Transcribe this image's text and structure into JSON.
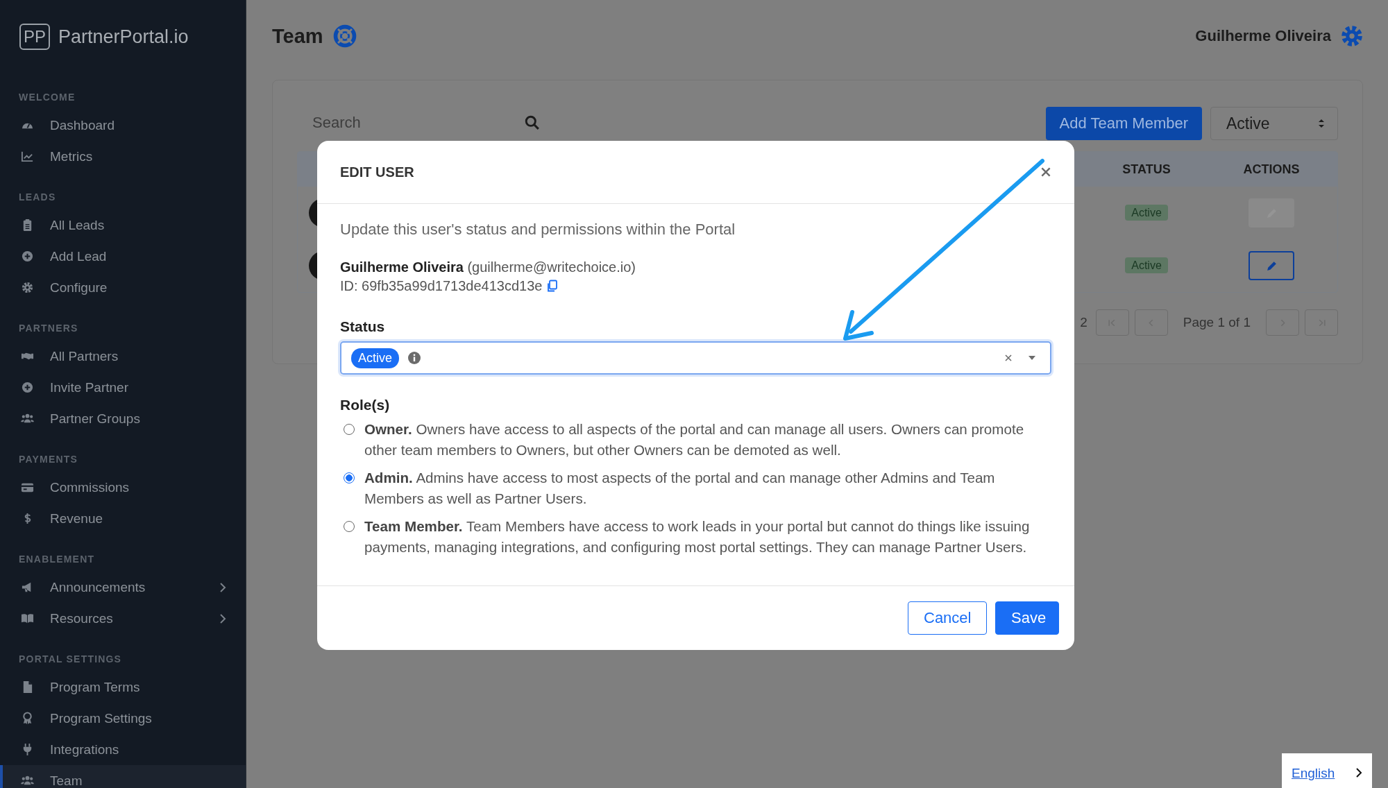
{
  "brand": {
    "logo_mark": "PP",
    "name": "PartnerPortal.io"
  },
  "sidebar": {
    "sections": [
      {
        "title": "WELCOME",
        "items": [
          {
            "label": "Dashboard",
            "selected": false,
            "has_submenu": false
          },
          {
            "label": "Metrics",
            "selected": false,
            "has_submenu": false
          }
        ]
      },
      {
        "title": "LEADS",
        "items": [
          {
            "label": "All Leads",
            "selected": false,
            "has_submenu": false
          },
          {
            "label": "Add Lead",
            "selected": false,
            "has_submenu": false
          },
          {
            "label": "Configure",
            "selected": false,
            "has_submenu": false
          }
        ]
      },
      {
        "title": "PARTNERS",
        "items": [
          {
            "label": "All Partners",
            "selected": false,
            "has_submenu": false
          },
          {
            "label": "Invite Partner",
            "selected": false,
            "has_submenu": false
          },
          {
            "label": "Partner Groups",
            "selected": false,
            "has_submenu": false
          }
        ]
      },
      {
        "title": "PAYMENTS",
        "items": [
          {
            "label": "Commissions",
            "selected": false,
            "has_submenu": false
          },
          {
            "label": "Revenue",
            "selected": false,
            "has_submenu": false
          }
        ]
      },
      {
        "title": "ENABLEMENT",
        "items": [
          {
            "label": "Announcements",
            "selected": false,
            "has_submenu": true
          },
          {
            "label": "Resources",
            "selected": false,
            "has_submenu": true
          }
        ]
      },
      {
        "title": "PORTAL SETTINGS",
        "items": [
          {
            "label": "Program Terms",
            "selected": false,
            "has_submenu": false
          },
          {
            "label": "Program Settings",
            "selected": false,
            "has_submenu": false
          },
          {
            "label": "Integrations",
            "selected": false,
            "has_submenu": false
          },
          {
            "label": "Team",
            "selected": true,
            "has_submenu": false
          }
        ]
      }
    ]
  },
  "header": {
    "title": "Team",
    "user_name": "Guilherme Oliveira"
  },
  "toolbar": {
    "search_placeholder": "Search",
    "add_button": "Add Team Member",
    "status_filter": "Active"
  },
  "table": {
    "columns": [
      "STATUS",
      "ACTIONS"
    ],
    "rows": [
      {
        "status": "Active",
        "edit_disabled": true
      },
      {
        "status": "Active",
        "edit_disabled": false
      }
    ]
  },
  "pagination": {
    "count_fragment": "2",
    "page_label": "Page 1 of 1"
  },
  "modal": {
    "title": "EDIT USER",
    "description": "Update this user's status and permissions within the Portal",
    "user_line": "**Guilherme Oliveira** (guilherme@writechoice.io)",
    "user_id": "ID: 69fb35a99d1713de413cd13e",
    "status_label": "Status",
    "status_value": "Active",
    "roles_label": "Role(s)",
    "roles": [
      {
        "text": "**Owner.** Owners have access to all aspects of the portal and can manage all users. Owners can promote other team members to Owners, but other Owners can be demoted as well.",
        "selected": false
      },
      {
        "text": "**Admin.** Admins have access to most aspects of the portal and can manage other Admins and Team Members as well as Partner Users.",
        "selected": true
      },
      {
        "text": "**Team Member.** Team Members have access to work leads in your portal but cannot do things like issuing payments, managing integrations, and configuring most portal settings. They can manage Partner Users.",
        "selected": false
      }
    ],
    "cancel_button": "Cancel",
    "save_button": "Save"
  },
  "language": {
    "label": "English"
  }
}
